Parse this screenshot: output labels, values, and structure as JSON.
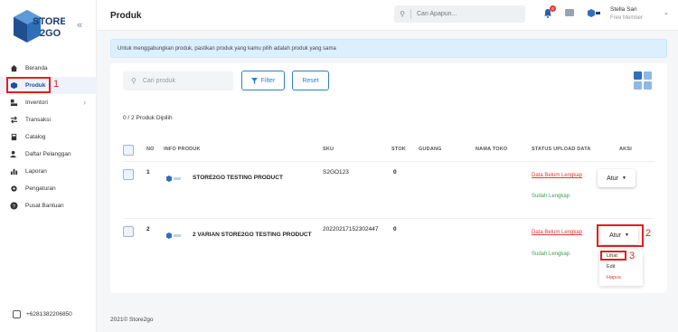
{
  "brand": {
    "line1": "STORE",
    "line2": "2GO"
  },
  "sidebar": {
    "items": [
      {
        "label": "Beranda",
        "icon": "home-icon"
      },
      {
        "label": "Produk",
        "icon": "cube-icon"
      },
      {
        "label": "Inventori",
        "icon": "boxes-icon"
      },
      {
        "label": "Transaksi",
        "icon": "swap-icon"
      },
      {
        "label": "Catalog",
        "icon": "book-icon"
      },
      {
        "label": "Daftar Pelanggan",
        "icon": "users-icon"
      },
      {
        "label": "Laporan",
        "icon": "chart-icon"
      },
      {
        "label": "Pengaturan",
        "icon": "gear-icon"
      },
      {
        "label": "Pusat Bantuan",
        "icon": "help-icon"
      }
    ],
    "phone": "+6281382206850"
  },
  "header": {
    "title": "Produk",
    "search_placeholder": "Cari Apapun...",
    "notif_count": "6",
    "user_name": "Stella Sari",
    "user_role": "Free Member"
  },
  "banner": "Untuk menggabungkan produk, pastikan produk yang kamu pilih adalah produk yang sama",
  "toolbar": {
    "search_placeholder": "Cari produk",
    "filter_label": "Filter",
    "reset_label": "Reset"
  },
  "selected_count": "0 / 2 Produk Dipilih",
  "table": {
    "headers": [
      "NO",
      "INFO PRODUK",
      "SKU",
      "STOK",
      "GUDANG",
      "NAMA TOKO",
      "STATUS UPLOAD DATA",
      "AKSI"
    ],
    "rows": [
      {
        "no": "1",
        "name": "STORE2GO TESTING PRODUCT",
        "sku": "S2GO123",
        "stok": "0",
        "status_pending": "Data Belum Lengkap",
        "status_done": "Sudah Lengkap",
        "action": "Atur"
      },
      {
        "no": "2",
        "name": "2 VARIAN STORE2GO TESTING PRODUCT",
        "sku": "20220217152302447",
        "stok": "0",
        "status_pending": "Data Belum Lengkap",
        "status_done": "Sudah Lengkap",
        "action": "Atur"
      }
    ]
  },
  "dropdown": {
    "items": [
      "Lihat",
      "Edit",
      "Hapus"
    ]
  },
  "annotations": [
    "1",
    "2",
    "3"
  ],
  "footer": "2021© Store2go",
  "colors": {
    "accent": "#2e7fd0",
    "danger": "#e53935",
    "success": "#3aa54b",
    "annotation": "#e02020"
  }
}
